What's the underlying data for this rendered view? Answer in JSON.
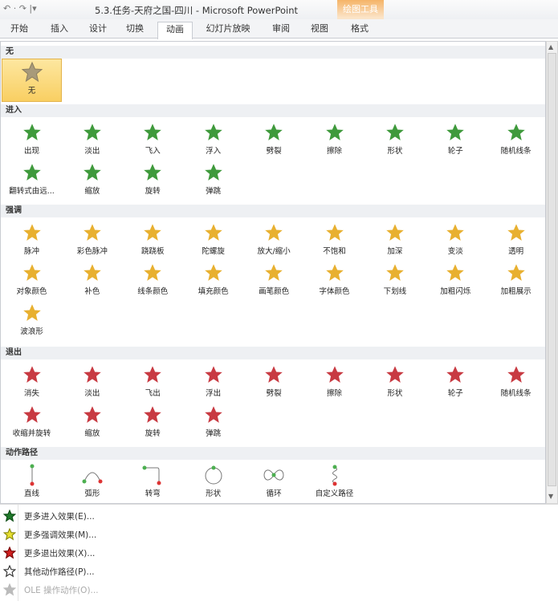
{
  "window": {
    "quick_access": "↶ · ↷ |▾",
    "title": "5.3.任务-天府之国-四川  -  Microsoft PowerPoint",
    "context_group": "绘图工具"
  },
  "tabs": [
    "开始",
    "插入",
    "设计",
    "切换",
    "动画",
    "幻灯片放映",
    "审阅",
    "视图",
    "格式"
  ],
  "active_tab": "动画",
  "colors": {
    "entrance": "#3f9a3c",
    "emphasis": "#e8b030",
    "exit": "#c83a42",
    "path": "#666666",
    "selected": "#f9cf62"
  },
  "sections": [
    {
      "title": "无",
      "kind": "none",
      "items": [
        "无"
      ]
    },
    {
      "title": "进入",
      "kind": "entrance",
      "items": [
        "出现",
        "淡出",
        "飞入",
        "浮入",
        "劈裂",
        "擦除",
        "形状",
        "轮子",
        "随机线条",
        "翻转式由远...",
        "缩放",
        "旋转",
        "弹跳"
      ]
    },
    {
      "title": "强调",
      "kind": "emphasis",
      "items": [
        "脉冲",
        "彩色脉冲",
        "跷跷板",
        "陀螺旋",
        "放大/缩小",
        "不饱和",
        "加深",
        "变淡",
        "透明",
        "对象颜色",
        "补色",
        "线条颜色",
        "填充颜色",
        "画笔颜色",
        "字体颜色",
        "下划线",
        "加粗闪烁",
        "加粗展示",
        "波浪形"
      ]
    },
    {
      "title": "退出",
      "kind": "exit",
      "items": [
        "消失",
        "淡出",
        "飞出",
        "浮出",
        "劈裂",
        "擦除",
        "形状",
        "轮子",
        "随机线条",
        "收缩并旋转",
        "缩放",
        "旋转",
        "弹跳"
      ]
    },
    {
      "title": "动作路径",
      "kind": "path",
      "items": [
        "直线",
        "弧形",
        "转弯",
        "形状",
        "循环",
        "自定义路径"
      ]
    }
  ],
  "menu": [
    {
      "label": "更多进入效果(E)...",
      "icon": "green-star-icon",
      "enabled": true
    },
    {
      "label": "更多强调效果(M)...",
      "icon": "yellow-star-icon",
      "enabled": true
    },
    {
      "label": "更多退出效果(X)...",
      "icon": "red-star-icon",
      "enabled": true
    },
    {
      "label": "其他动作路径(P)...",
      "icon": "outline-star-icon",
      "enabled": true
    },
    {
      "label": "OLE 操作动作(O)...",
      "icon": "ole-action-icon",
      "enabled": false
    }
  ]
}
